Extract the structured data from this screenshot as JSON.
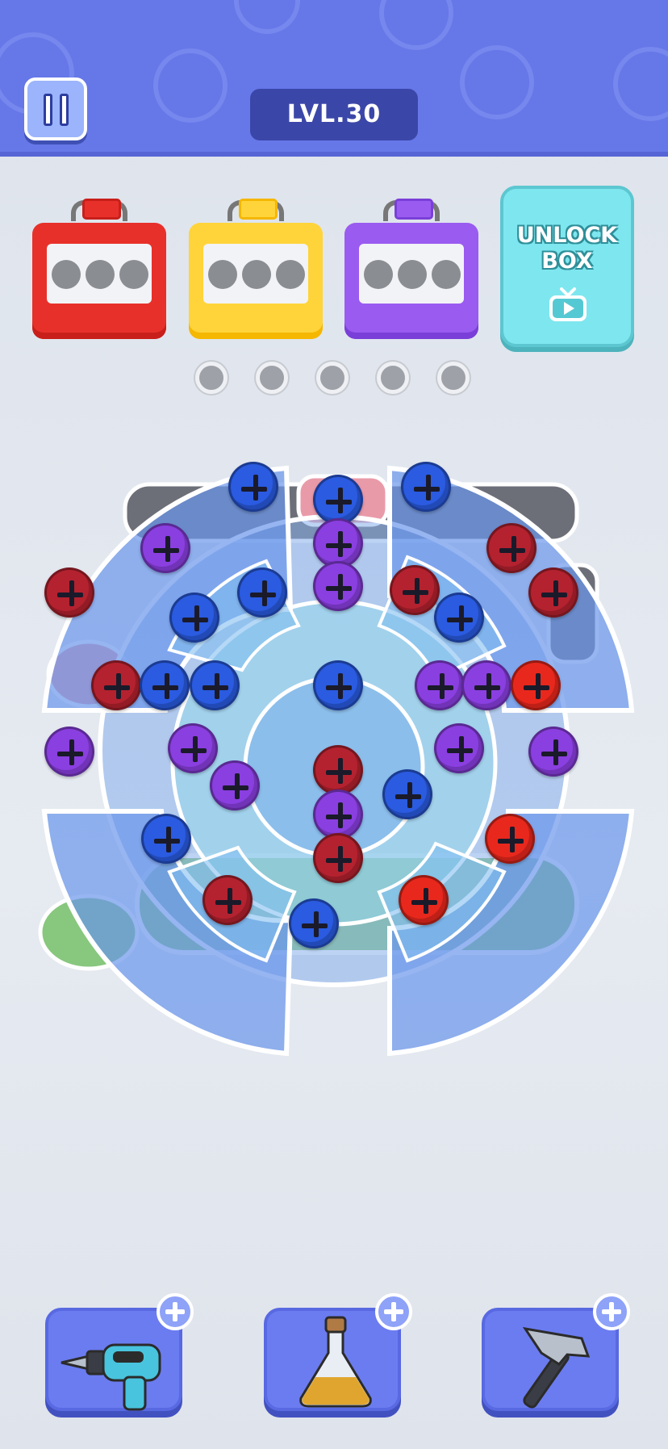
{
  "header": {
    "level_label": "LVL.30",
    "pause_icon": "pause-icon"
  },
  "boxes": [
    {
      "color_name": "red",
      "color": "#e8302a",
      "edge": "#c81f1a",
      "lid": "#e8302a",
      "empty_slots": 3
    },
    {
      "color_name": "yellow",
      "color": "#ffd43a",
      "edge": "#f5b700",
      "lid": "#ffd43a",
      "empty_slots": 3
    },
    {
      "color_name": "purple",
      "color": "#9a5bf0",
      "edge": "#7a3fd8",
      "lid": "#9a5bf0",
      "empty_slots": 3
    }
  ],
  "unlock_box": {
    "label": "UNLOCK\nBOX",
    "icon": "tv-play-icon"
  },
  "holes": {
    "count": 5
  },
  "screw_colors": {
    "blue": "#2a5be0",
    "purple": "#8a3fe0",
    "darkred": "#b4222f",
    "red": "#e8281d"
  },
  "screws": [
    {
      "color": "blue"
    },
    {
      "color": "blue"
    },
    {
      "color": "purple"
    },
    {
      "color": "blue"
    },
    {
      "color": "darkred"
    },
    {
      "color": "blue"
    },
    {
      "color": "purple"
    },
    {
      "color": "purple"
    },
    {
      "color": "darkred"
    },
    {
      "color": "darkred"
    },
    {
      "color": "blue"
    },
    {
      "color": "blue"
    },
    {
      "color": "darkred"
    },
    {
      "color": "darkred"
    },
    {
      "color": "blue"
    },
    {
      "color": "blue"
    },
    {
      "color": "blue"
    },
    {
      "color": "purple"
    },
    {
      "color": "purple"
    },
    {
      "color": "red"
    },
    {
      "color": "purple"
    },
    {
      "color": "purple"
    },
    {
      "color": "purple"
    },
    {
      "color": "purple"
    },
    {
      "color": "purple"
    },
    {
      "color": "darkred"
    },
    {
      "color": "blue"
    },
    {
      "color": "purple"
    },
    {
      "color": "blue"
    },
    {
      "color": "red"
    },
    {
      "color": "darkred"
    },
    {
      "color": "darkred"
    },
    {
      "color": "red"
    },
    {
      "color": "blue"
    }
  ],
  "tools": [
    {
      "name": "drill",
      "icon": "drill-icon"
    },
    {
      "name": "potion",
      "icon": "potion-icon"
    },
    {
      "name": "hammer",
      "icon": "hammer-icon"
    }
  ]
}
